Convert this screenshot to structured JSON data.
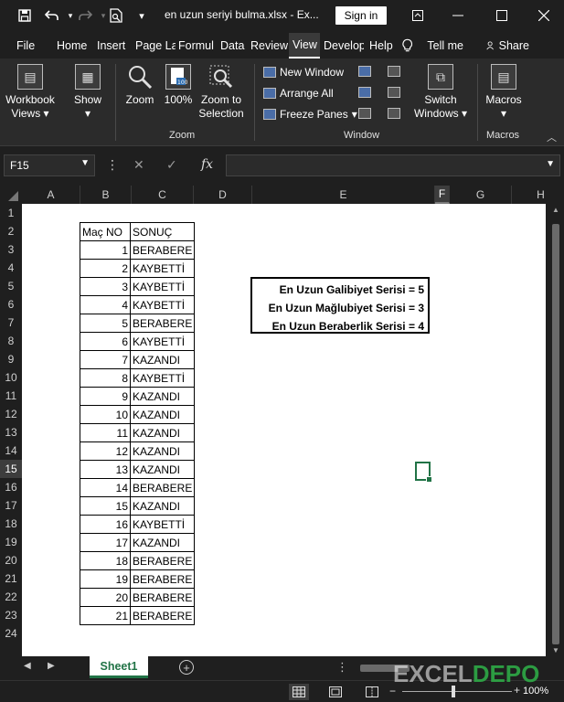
{
  "titlebar": {
    "file_title": "en uzun seriyi bulma.xlsx  -  Ex...",
    "signin_label": "Sign in"
  },
  "menu": [
    "File",
    "Home",
    "Insert",
    "Page La",
    "Formul",
    "Data",
    "Review",
    "View",
    "Develop",
    "Help"
  ],
  "tell_me": "Tell me",
  "share": "Share",
  "ribbon": {
    "workbook_views": "Workbook Views",
    "show": "Show",
    "zoom": "Zoom",
    "zoom100": "100%",
    "zoom_selection": "Zoom to Selection",
    "zoom_group": "Zoom",
    "new_window": "New Window",
    "arrange_all": "Arrange All",
    "freeze_panes": "Freeze Panes",
    "switch_windows": "Switch Windows",
    "window_group": "Window",
    "macros": "Macros",
    "macros_group": "Macros"
  },
  "formula_bar": {
    "name_box": "F15",
    "fx": "fx"
  },
  "columns": [
    "A",
    "B",
    "C",
    "D",
    "E",
    "F",
    "G",
    "H"
  ],
  "selected_column": "F",
  "rows": [
    "1",
    "2",
    "3",
    "4",
    "5",
    "6",
    "7",
    "8",
    "9",
    "10",
    "11",
    "12",
    "13",
    "14",
    "15",
    "16",
    "17",
    "18",
    "19",
    "20",
    "21",
    "22",
    "23",
    "24"
  ],
  "selected_row": "15",
  "table": {
    "headers": [
      "Maç NO",
      "SONUÇ"
    ],
    "rows": [
      [
        "1",
        "BERABERE"
      ],
      [
        "2",
        "KAYBETTİ"
      ],
      [
        "3",
        "KAYBETTİ"
      ],
      [
        "4",
        "KAYBETTİ"
      ],
      [
        "5",
        "BERABERE"
      ],
      [
        "6",
        "KAYBETTİ"
      ],
      [
        "7",
        "KAZANDI"
      ],
      [
        "8",
        "KAYBETTİ"
      ],
      [
        "9",
        "KAZANDI"
      ],
      [
        "10",
        "KAZANDI"
      ],
      [
        "11",
        "KAZANDI"
      ],
      [
        "12",
        "KAZANDI"
      ],
      [
        "13",
        "KAZANDI"
      ],
      [
        "14",
        "BERABERE"
      ],
      [
        "15",
        "KAZANDI"
      ],
      [
        "16",
        "KAYBETTİ"
      ],
      [
        "17",
        "KAZANDI"
      ],
      [
        "18",
        "BERABERE"
      ],
      [
        "19",
        "BERABERE"
      ],
      [
        "20",
        "BERABERE"
      ],
      [
        "21",
        "BERABERE"
      ]
    ]
  },
  "summary": [
    "En Uzun Galibiyet Serisi = 5",
    "En Uzun Mağlubiyet Serisi = 3",
    "En Uzun Beraberlik Serisi = 4"
  ],
  "sheet_tab": "Sheet1",
  "zoom_level": "100%",
  "watermark": {
    "left": "EXCEL",
    "right": "DEPO"
  },
  "colors": {
    "accent": "#217346",
    "background": "#1f1f1f",
    "ribbon": "#2b2b2b"
  }
}
